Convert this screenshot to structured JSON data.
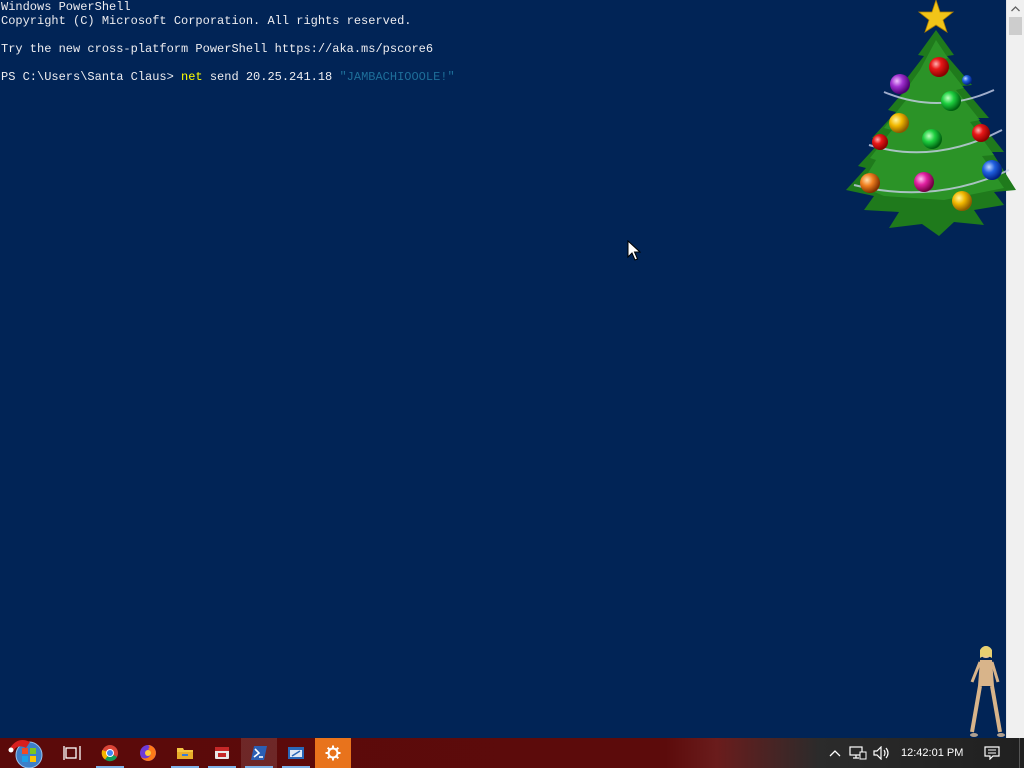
{
  "console": {
    "header_line1": "Windows PowerShell",
    "header_line2": "Copyright (C) Microsoft Corporation. All rights reserved.",
    "try_line": "Try the new cross-platform PowerShell https://aka.ms/pscore6",
    "prompt": "PS C:\\Users\\Santa Claus> ",
    "command_keyword": "net",
    "command_args": " send 20.25.241.18 ",
    "command_string": "\"JAMBACHIOOOLE!\""
  },
  "colors": {
    "console_bg": "#012456",
    "console_text": "#eeedf0",
    "keyword": "#ffff00",
    "string": "#1e6f9a",
    "taskbar": "#5b0a0a",
    "settings_tile": "#e8731c"
  },
  "taskbar": {
    "clock": "12:42:01 PM",
    "items": [
      {
        "name": "start",
        "icon": "windows-orb-icon"
      },
      {
        "name": "task-view",
        "icon": "task-view-icon"
      },
      {
        "name": "chrome",
        "icon": "chrome-icon"
      },
      {
        "name": "firefox",
        "icon": "firefox-icon"
      },
      {
        "name": "file-explorer",
        "icon": "folder-icon"
      },
      {
        "name": "app-red",
        "icon": "app-icon"
      },
      {
        "name": "powershell",
        "icon": "powershell-icon"
      },
      {
        "name": "app-window",
        "icon": "window-app-icon"
      },
      {
        "name": "settings",
        "icon": "gear-icon"
      }
    ],
    "tray": [
      "chevron-up-icon",
      "network-icon",
      "volume-icon",
      "notification-icon"
    ]
  }
}
